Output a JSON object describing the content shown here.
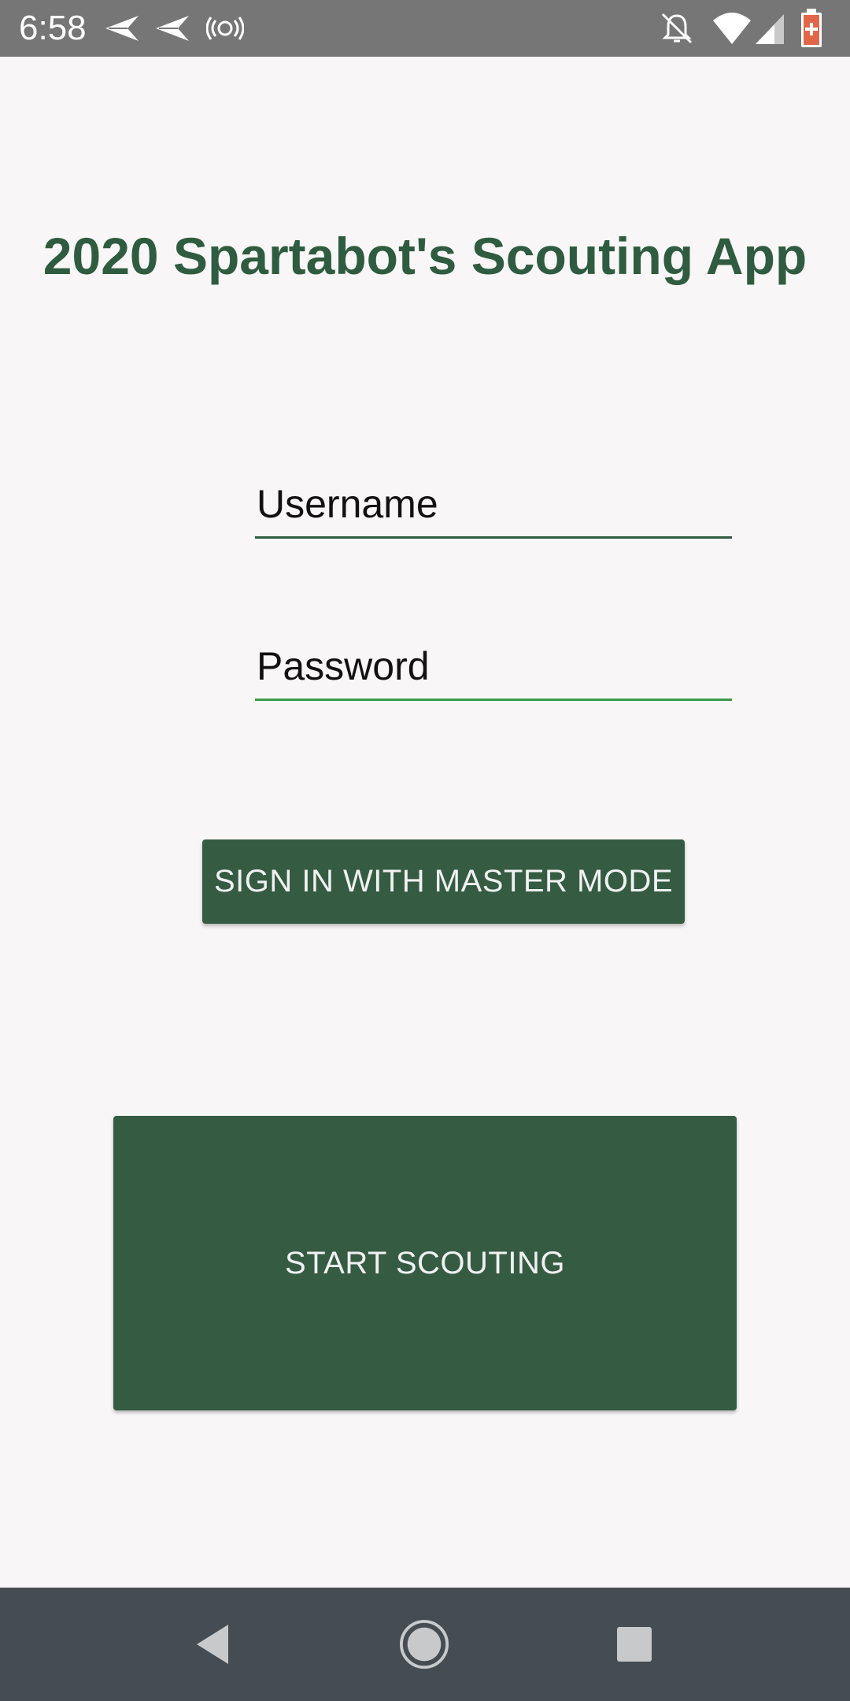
{
  "status_bar": {
    "time": "6:58",
    "left_icons": [
      "send-icon",
      "send-icon",
      "broadcast-icon"
    ],
    "right_icons": [
      "notifications-off-icon",
      "wifi-icon",
      "signal-icon",
      "battery-icon"
    ]
  },
  "app": {
    "title": "2020 Spartabot's Scouting App"
  },
  "form": {
    "username_placeholder": "Username",
    "password_placeholder": "Password",
    "master_button_label": "SIGN IN WITH MASTER MODE",
    "start_button_label": "START SCOUTING"
  },
  "nav_bar": {
    "icons": [
      "back-icon",
      "home-icon",
      "recents-icon"
    ]
  },
  "colors": {
    "primary": "#355c43",
    "title": "#2f5c40",
    "background": "#f8f6f7",
    "status_bar": "#767676",
    "nav_bar": "#454c52",
    "battery_alert": "#e2674a"
  }
}
